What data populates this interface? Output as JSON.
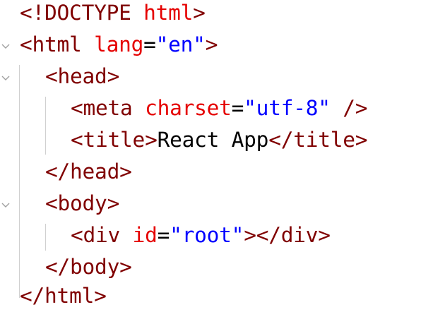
{
  "editor": {
    "lines": [
      {
        "tokens": {
          "open": "<!",
          "tag": "DOCTYPE",
          "attr": " html",
          "close": ">"
        }
      },
      {
        "tokens": {
          "open": "<",
          "tag": "html",
          "attr": " lang",
          "eq": "=",
          "val": "\"en\"",
          "close": ">"
        }
      },
      {
        "tokens": {
          "open": "<",
          "tag": "head",
          "close": ">"
        }
      },
      {
        "tokens": {
          "open": "<",
          "tag": "meta",
          "attr": " charset",
          "eq": "=",
          "val": "\"utf-8\"",
          "close": " />"
        }
      },
      {
        "tokens": {
          "open": "<",
          "tag": "title",
          "close": ">",
          "text": "React App",
          "open2": "</",
          "tag2": "title",
          "close2": ">"
        }
      },
      {
        "tokens": {
          "open": "</",
          "tag": "head",
          "close": ">"
        }
      },
      {
        "tokens": {
          "open": "<",
          "tag": "body",
          "close": ">"
        }
      },
      {
        "tokens": {
          "open": "<",
          "tag": "div",
          "attr": " id",
          "eq": "=",
          "val": "\"root\"",
          "close": ">",
          "open2": "</",
          "tag2": "div",
          "close2": ">"
        }
      },
      {
        "tokens": {
          "open": "</",
          "tag": "body",
          "close": ">"
        }
      },
      {
        "tokens": {
          "open": "</",
          "tag": "html",
          "close": ">"
        }
      }
    ]
  },
  "colors": {
    "tag": "#800000",
    "attribute": "#e50000",
    "value": "#0000ff",
    "text": "#000000",
    "indent_guide": "#d0d0d0"
  },
  "icons": {
    "fold": "chevron-down-icon"
  }
}
